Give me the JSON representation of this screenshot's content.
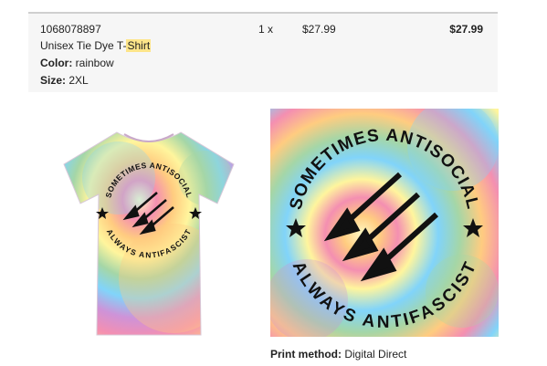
{
  "order_item": {
    "sku": "1068078897",
    "product_name_prefix": "Unisex Tie Dye T-",
    "product_name_highlight": "Shirt",
    "color_label": "Color:",
    "color_value": "rainbow",
    "size_label": "Size:",
    "size_value": "2XL",
    "quantity": "1 x",
    "unit_price": "$27.99",
    "line_total": "$27.99"
  },
  "design": {
    "top_text": "SOMETIMES ANTISOCIAL",
    "bottom_text": "ALWAYS ANTIFASCIST"
  },
  "print_method": {
    "label": "Print method:",
    "value": "Digital Direct"
  },
  "colors": {
    "highlight": "#fde58a",
    "row_background": "#f6f6f6",
    "tie_dye": [
      "#f48fb1",
      "#ffcc80",
      "#fff59d",
      "#a5d6a7",
      "#81d4fa",
      "#ce93d8"
    ]
  }
}
